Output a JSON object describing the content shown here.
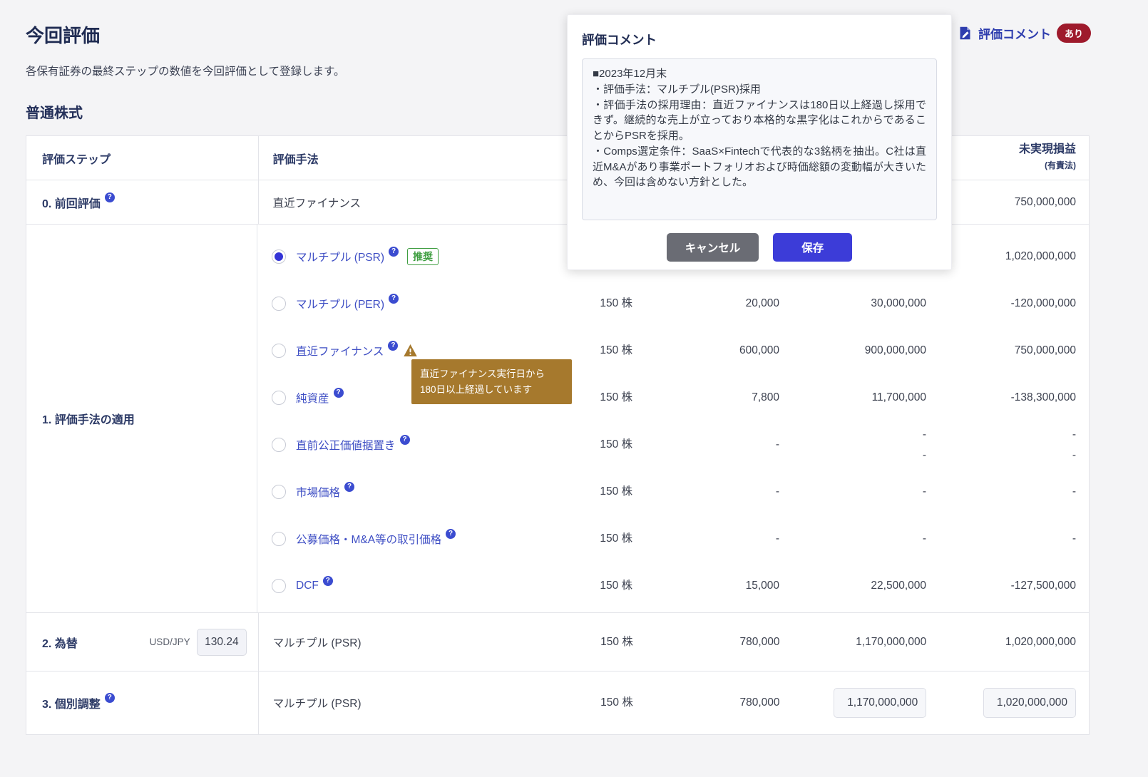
{
  "page": {
    "title": "今回評価",
    "subtitle": "各保有証券の最終ステップの数値を今回評価として登録します。",
    "section_title": "普通株式"
  },
  "icons": {
    "help": "?"
  },
  "comment_link": {
    "label": "評価コメント",
    "badge": "あり"
  },
  "dialog": {
    "title": "評価コメント",
    "comment": "■2023年12月末\n・評価手法：マルチプル(PSR)採用\n・評価手法の採用理由：直近ファイナンスは180日以上経過し採用できず。継続的な売上が立っており本格的な黒字化はこれからであることからPSRを採用。\n・Comps選定条件：SaaS×Fintechで代表的な3銘柄を抽出。C社は直近M&Aがあり事業ポートフォリオおよび時価総額の変動幅が大きいため、今回は含めない方針とした。",
    "cancel_label": "キャンセル",
    "save_label": "保存"
  },
  "tooltip": {
    "text": "直近ファイナンス実行日から\n180日以上経過しています"
  },
  "table": {
    "headers": {
      "step": "評価ステップ",
      "method": "評価手法",
      "qty": "",
      "price": "",
      "value": "",
      "pl_main": "未実現損益",
      "pl_sub": "(有責法)"
    },
    "row0": {
      "step": "0. 前回評価",
      "method": "直近ファイナンス",
      "qty": "",
      "price": "",
      "value": "",
      "pl": "750,000,000"
    },
    "row1": {
      "step": "1. 評価手法の適用",
      "recommend_badge": "推奨",
      "methods": [
        {
          "label": "マルチプル (PSR)",
          "selected": true,
          "qty": "",
          "price": "",
          "value": "",
          "pl": "1,020,000,000"
        },
        {
          "label": "マルチプル (PER)",
          "selected": false,
          "qty": "150 株",
          "price": "20,000",
          "value": "30,000,000",
          "pl": "-120,000,000"
        },
        {
          "label": "直近ファイナンス",
          "selected": false,
          "qty": "150 株",
          "price": "600,000",
          "value": "900,000,000",
          "pl": "750,000,000"
        },
        {
          "label": "純資産",
          "selected": false,
          "qty": "150 株",
          "price": "7,800",
          "value": "11,700,000",
          "pl": "-138,300,000"
        },
        {
          "label": "直前公正価値据置き",
          "selected": false,
          "qty": "150 株",
          "price": "-",
          "value": "-\n-",
          "pl": "-\n-"
        },
        {
          "label": "市場価格",
          "selected": false,
          "qty": "150 株",
          "price": "-",
          "value": "-",
          "pl": "-"
        },
        {
          "label": "公募価格・M&A等の取引価格",
          "selected": false,
          "qty": "150 株",
          "price": "-",
          "value": "-",
          "pl": "-"
        },
        {
          "label": "DCF",
          "selected": false,
          "qty": "150 株",
          "price": "15,000",
          "value": "22,500,000",
          "pl": "-127,500,000"
        }
      ]
    },
    "row2": {
      "step": "2. 為替",
      "fx_pair": "USD/JPY",
      "fx_rate": "130.24",
      "method": "マルチプル (PSR)",
      "qty": "150 株",
      "price": "780,000",
      "value": "1,170,000,000",
      "pl": "1,020,000,000"
    },
    "row3": {
      "step": "3. 個別調整",
      "method": "マルチプル (PSR)",
      "qty": "150 株",
      "price": "780,000",
      "value_input": "1,170,000,000",
      "pl_input": "1,020,000,000"
    }
  },
  "colors": {
    "accent": "#3c3cd8",
    "link": "#3e4ec4",
    "navy": "#2c3a66",
    "badge_red": "#9e1a2c",
    "warning_brown": "#a6792d",
    "recommend_green": "#3f9e41"
  }
}
